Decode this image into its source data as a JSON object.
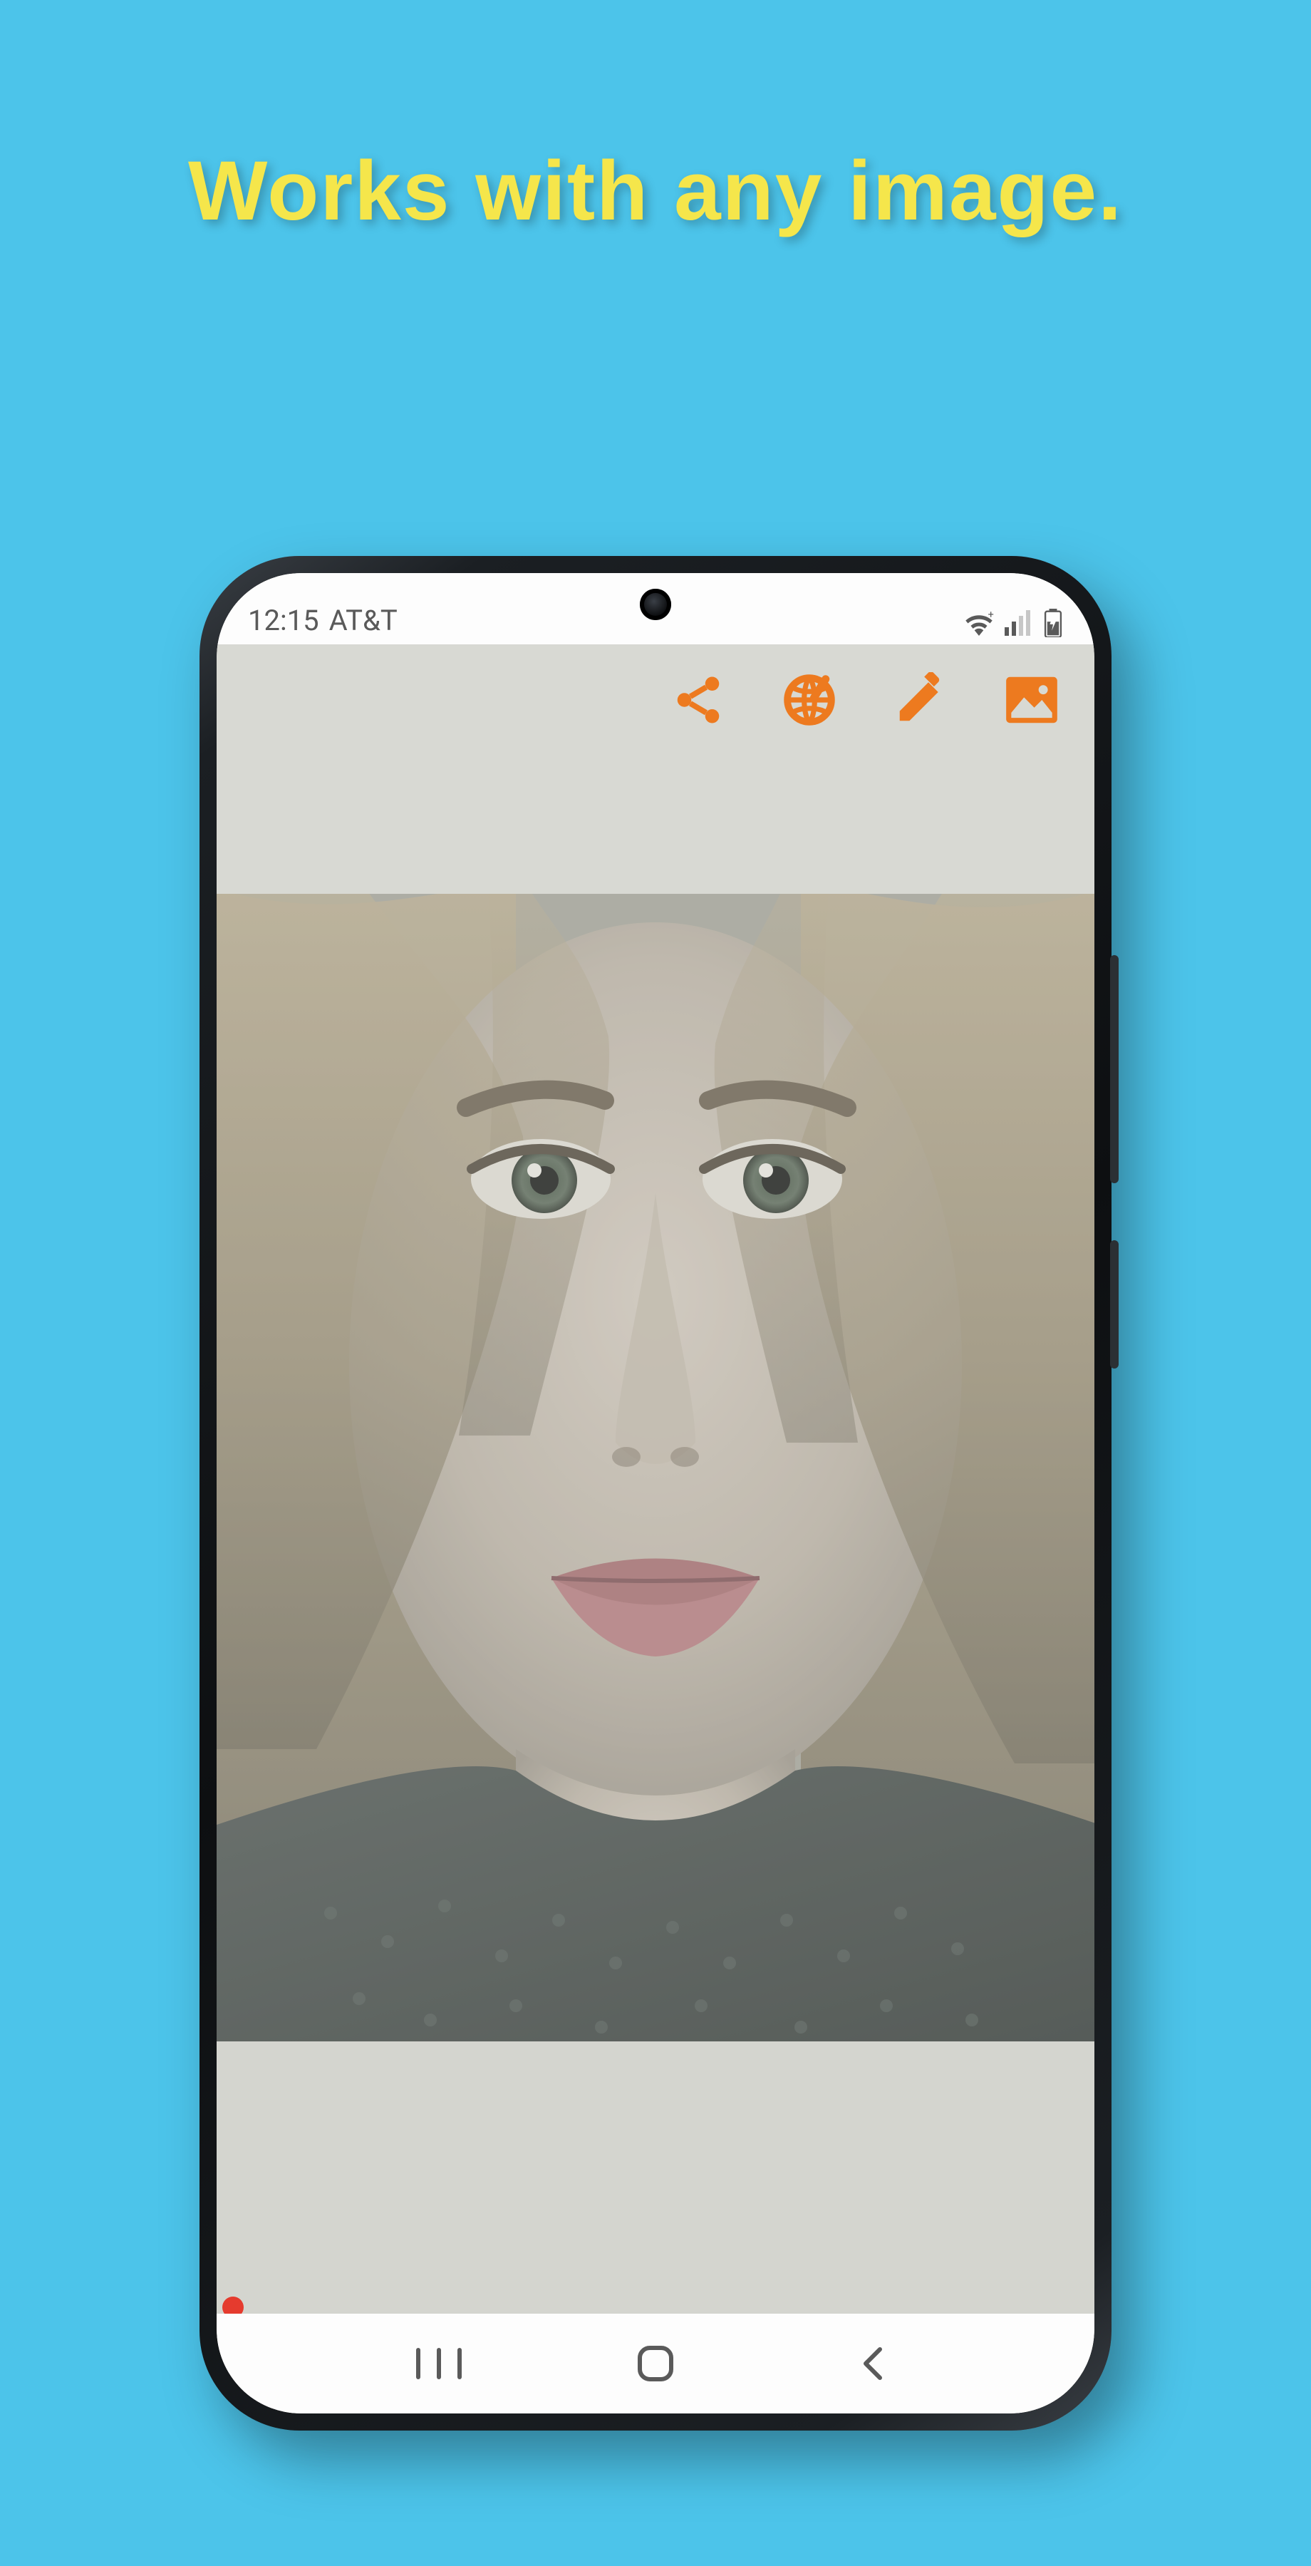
{
  "headline": "Works with any image.",
  "statusbar": {
    "time": "12:15",
    "carrier": "AT&T"
  },
  "toolbar": {
    "share_icon": "share-icon",
    "globe_icon": "globe-icon",
    "edit_icon": "pencil-icon",
    "image_icon": "image-icon"
  },
  "navbar": {
    "recents_icon": "recents-icon",
    "home_icon": "home-icon",
    "back_icon": "back-icon"
  },
  "colors": {
    "background": "#4cc4ea",
    "headline": "#f5e64b",
    "accent": "#ed7a1f",
    "screen_fill": "#d4d5cf"
  }
}
